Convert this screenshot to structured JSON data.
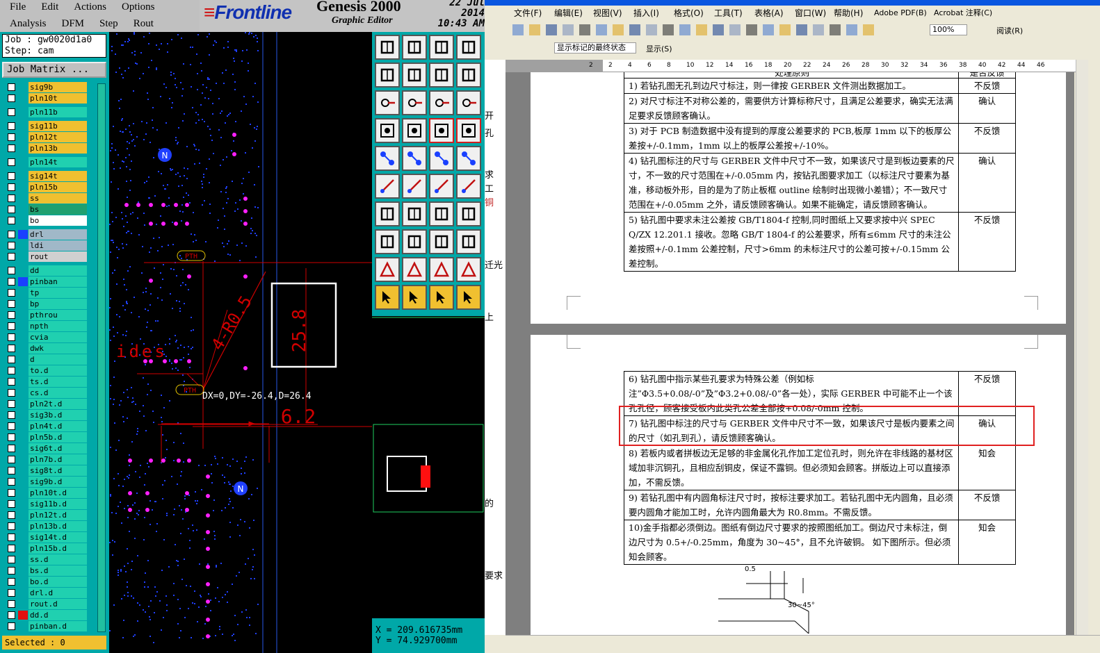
{
  "genesis": {
    "menu_row1": [
      "File",
      "Edit",
      "Actions",
      "Options"
    ],
    "menu_row2": [
      "Analysis",
      "DFM",
      "Step",
      "Rout"
    ],
    "brand": "Frontline",
    "product": "Genesis 2000",
    "product_sub": "Graphic Editor",
    "date": "22 Jul 2014",
    "time": "10:43 AM",
    "job_label": "Job : gw0020d1a0",
    "step_label": "Step: cam",
    "job_matrix_button": "Job Matrix ...",
    "layers": [
      {
        "name": "sig9b",
        "bg": "#f0c030"
      },
      {
        "name": "pln10t",
        "bg": "#f0c030"
      },
      {
        "name": "pln11b",
        "bg": "#20d0b0"
      },
      {
        "name": "sig11b",
        "bg": "#f0c030"
      },
      {
        "name": "pln12t",
        "bg": "#f0c030"
      },
      {
        "name": "pln13b",
        "bg": "#f0c030"
      },
      {
        "name": "pln14t",
        "bg": "#20d0b0"
      },
      {
        "name": "sig14t",
        "bg": "#f0c030"
      },
      {
        "name": "pln15b",
        "bg": "#f0c030"
      },
      {
        "name": "ss",
        "bg": "#f0c030"
      },
      {
        "name": "bs",
        "bg": "#20a070"
      },
      {
        "name": "bo",
        "bg": "#ffffff"
      },
      {
        "name": "drl",
        "bg": "#a0b8c8"
      },
      {
        "name": "ldi",
        "bg": "#a0b8c8"
      },
      {
        "name": "rout",
        "bg": "#d0d0d0"
      },
      {
        "name": "dd",
        "bg": "#20d0b0"
      },
      {
        "name": "pinban",
        "bg": "#20d0b0"
      },
      {
        "name": "tp",
        "bg": "#20d0b0"
      },
      {
        "name": "bp",
        "bg": "#20d0b0"
      },
      {
        "name": "pthrou",
        "bg": "#20d0b0"
      },
      {
        "name": "npth",
        "bg": "#20d0b0"
      },
      {
        "name": "cvia",
        "bg": "#20d0b0"
      },
      {
        "name": "dwk",
        "bg": "#20d0b0"
      },
      {
        "name": "d",
        "bg": "#20d0b0"
      },
      {
        "name": "to.d",
        "bg": "#20d0b0"
      },
      {
        "name": "ts.d",
        "bg": "#20d0b0"
      },
      {
        "name": "cs.d",
        "bg": "#20d0b0"
      },
      {
        "name": "pln2t.d",
        "bg": "#20d0b0"
      },
      {
        "name": "sig3b.d",
        "bg": "#20d0b0"
      },
      {
        "name": "pln4t.d",
        "bg": "#20d0b0"
      },
      {
        "name": "pln5b.d",
        "bg": "#20d0b0"
      },
      {
        "name": "sig6t.d",
        "bg": "#20d0b0"
      },
      {
        "name": "pln7b.d",
        "bg": "#20d0b0"
      },
      {
        "name": "sig8t.d",
        "bg": "#20d0b0"
      },
      {
        "name": "sig9b.d",
        "bg": "#20d0b0"
      },
      {
        "name": "pln10t.d",
        "bg": "#20d0b0"
      },
      {
        "name": "sig11b.d",
        "bg": "#20d0b0"
      },
      {
        "name": "pln12t.d",
        "bg": "#20d0b0"
      },
      {
        "name": "pln13b.d",
        "bg": "#20d0b0"
      },
      {
        "name": "sig14t.d",
        "bg": "#20d0b0"
      },
      {
        "name": "pln15b.d",
        "bg": "#20d0b0"
      },
      {
        "name": "ss.d",
        "bg": "#20d0b0"
      },
      {
        "name": "bs.d",
        "bg": "#20d0b0"
      },
      {
        "name": "bo.d",
        "bg": "#20d0b0"
      },
      {
        "name": "drl.d",
        "bg": "#20d0b0"
      },
      {
        "name": "rout.d",
        "bg": "#20d0b0"
      },
      {
        "name": "dd.d",
        "bg": "#20d0b0"
      },
      {
        "name": "pinban.d",
        "bg": "#20d0b0"
      }
    ],
    "selected_label": "Selected : 0",
    "canvas": {
      "measure_text": "DX=0,DY=-26.4,D=26.4",
      "dim_25_8": "25.8",
      "dim_6_2": "6.2",
      "dim_r05": "4-R0.5",
      "label_ides": "ides",
      "pth_label": "PTH",
      "n_marker": "N"
    },
    "coord_x": "X = 209.616735mm",
    "coord_y": "Y = 74.929700mm"
  },
  "word": {
    "menu": [
      "文件(F)",
      "编辑(E)",
      "视图(V)",
      "插入(I)",
      "格式(O)",
      "工具(T)",
      "表格(A)",
      "窗口(W)",
      "帮助(H)",
      "Adobe PDF(B)",
      "Acrobat 注释(C)"
    ],
    "zoom": "100%",
    "reading_button": "阅读(R)",
    "markup_select": "显示标记的最终状态",
    "show_button": "显示(S)",
    "ruler_numbers": [
      "2",
      "2",
      "4",
      "6",
      "8",
      "10",
      "12",
      "14",
      "16",
      "18",
      "20",
      "22",
      "24",
      "26",
      "28",
      "30",
      "32",
      "34",
      "36",
      "38",
      "40",
      "42",
      "44",
      "46"
    ],
    "header_partial": "处理原则",
    "header_feedback_partial": "是否反馈",
    "rows_page1": [
      {
        "text": "1) 若钻孔图无孔到边尺寸标注，则一律按 GERBER 文件测出数据加工。",
        "feedback": "不反馈"
      },
      {
        "text": "2) 对尺寸标注不对称公差的，需要供方计算标称尺寸，且满足公差要求，确实无法满足要求反馈顾客确认。",
        "feedback": "确认"
      },
      {
        "text": "3) 对于 PCB 制造数据中没有提到的厚度公差要求的 PCB,板厚 1mm 以下的板厚公差按+/-0.1mm，1mm 以上的板厚公差按+/-10%。",
        "feedback": "不反馈"
      },
      {
        "text": "4) 钻孔图标注的尺寸与 GERBER 文件中尺寸不一致，如果该尺寸是到板边要素的尺寸，不一致的尺寸范围在+/-0.05mm 内，按钻孔图要求加工（以标注尺寸要素为基准，移动板外形，目的是为了防止板框 outline 绘制时出现微小差错）；不一致尺寸范围在+/-0.05mm 之外，请反馈顾客确认。如果不能确定，请反馈顾客确认。",
        "feedback": "确认"
      },
      {
        "text": "5) 钻孔图中要求未注公差按 GB/T1804-f 控制,同时图纸上又要求按中兴 SPEC Q/ZX 12.201.1 接收。忽略 GB/T 1804-f 的公差要求，所有≤6mm 尺寸的未注公差按照+/-0.1mm 公差控制，尺寸>6mm 的未标注尺寸的公差可按+/-0.15mm 公差控制。",
        "feedback": "不反馈"
      }
    ],
    "rows_page2": [
      {
        "text": "6) 钻孔图中指示某些孔要求为特殊公差（例如标注”Φ3.5+0.08/-0”及”Φ3.2+0.08/-0”各一处），实际 GERBER 中可能不止一个该孔孔径，顾客接受板内此类孔公差全部按+0.08/-0mm 控制。",
        "feedback": "不反馈"
      },
      {
        "text": "7) 钻孔图中标注的尺寸与 GERBER 文件中尺寸不一致，如果该尺寸是板内要素之间的尺寸（如孔到孔），请反馈顾客确认。",
        "feedback": "确认"
      },
      {
        "text": "8) 若板内或者拼板边无足够的非金属化孔作加工定位孔时，则允许在非线路的基材区域加非沉铜孔，且相应刮铜皮，保证不露铜。但必须知会顾客。拼版边上可以直接添加，不需反馈。",
        "feedback": "知会"
      },
      {
        "text": "9) 若钻孔图中有内圆角标注尺寸时，按标注要求加工。若钻孔图中无内圆角，且必须要内圆角才能加工时，允许内圆角最大为 R0.8mm。不需反馈。",
        "feedback": "不反馈"
      },
      {
        "text": "10)金手指都必须倒边。图纸有倒边尺寸要求的按照图纸加工。倒边尺寸未标注，倒边尺寸为 0.5+/-0.25mm，角度为 30~45°，且不允许破铜。 如下图所示。但必须知会顾客。",
        "feedback": "知会"
      }
    ],
    "figure_dim": "0.5",
    "figure_angle": "30~45°",
    "left_fragments": [
      "开",
      "孔",
      "求",
      "工",
      "铜",
      "迁光",
      "上",
      "的",
      "要求"
    ]
  }
}
